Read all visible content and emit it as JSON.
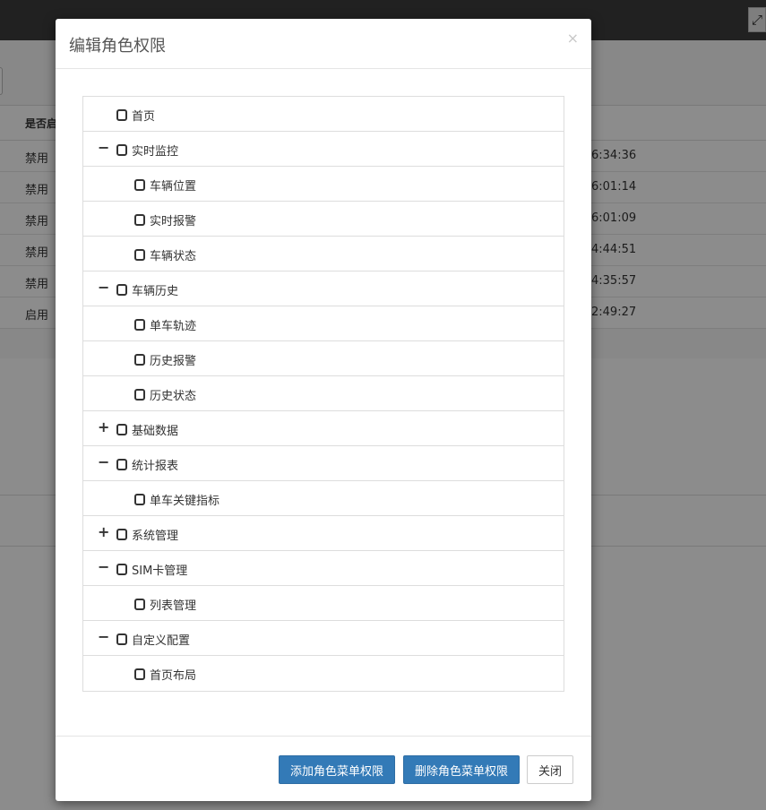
{
  "background": {
    "table_header_status": "是否启",
    "fullscreen_icon": "expand-icon",
    "rows": [
      {
        "status": "禁用",
        "time": "6:34:36"
      },
      {
        "status": "禁用",
        "time": "6:01:14"
      },
      {
        "status": "禁用",
        "time": "6:01:09"
      },
      {
        "status": "禁用",
        "time": "4:44:51"
      },
      {
        "status": "禁用",
        "time": "4:35:57"
      },
      {
        "status": "启用",
        "time": "2:49:27"
      }
    ]
  },
  "modal": {
    "title": "编辑角色权限",
    "close_symbol": "×",
    "tree": [
      {
        "label": "首页",
        "level": 0,
        "toggle": ""
      },
      {
        "label": "实时监控",
        "level": 0,
        "toggle": "−"
      },
      {
        "label": "车辆位置",
        "level": 1,
        "toggle": ""
      },
      {
        "label": "实时报警",
        "level": 1,
        "toggle": ""
      },
      {
        "label": "车辆状态",
        "level": 1,
        "toggle": ""
      },
      {
        "label": "车辆历史",
        "level": 0,
        "toggle": "−"
      },
      {
        "label": "单车轨迹",
        "level": 1,
        "toggle": ""
      },
      {
        "label": "历史报警",
        "level": 1,
        "toggle": ""
      },
      {
        "label": "历史状态",
        "level": 1,
        "toggle": ""
      },
      {
        "label": "基础数据",
        "level": 0,
        "toggle": "+"
      },
      {
        "label": "统计报表",
        "level": 0,
        "toggle": "−"
      },
      {
        "label": "单车关键指标",
        "level": 1,
        "toggle": ""
      },
      {
        "label": "系统管理",
        "level": 0,
        "toggle": "+"
      },
      {
        "label": "SIM卡管理",
        "level": 0,
        "toggle": "−"
      },
      {
        "label": "列表管理",
        "level": 1,
        "toggle": ""
      },
      {
        "label": "自定义配置",
        "level": 0,
        "toggle": "−"
      },
      {
        "label": "首页布局",
        "level": 1,
        "toggle": ""
      }
    ],
    "footer": {
      "add_label": "添加角色菜单权限",
      "delete_label": "删除角色菜单权限",
      "close_label": "关闭"
    }
  }
}
